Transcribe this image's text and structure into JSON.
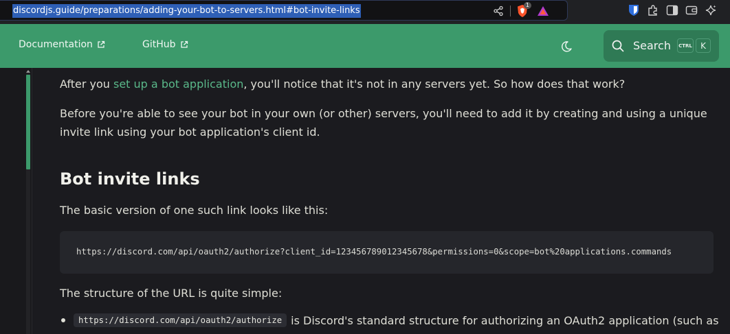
{
  "browser": {
    "url": "discordjs.guide/preparations/adding-your-bot-to-servers.html#bot-invite-links",
    "icons": [
      "share-icon",
      "brave-shield-icon",
      "brave-rewards-icon",
      "bitwarden-icon",
      "extensions-icon",
      "sidebar-icon",
      "wallet-icon",
      "leo-ai-icon"
    ],
    "brave_badge": "1"
  },
  "header": {
    "nav": [
      {
        "label": "Documentation",
        "icon": "external-link-icon"
      },
      {
        "label": "GitHub",
        "icon": "external-link-icon"
      }
    ],
    "theme_icon": "moon-icon",
    "search": {
      "label": "Search",
      "kbd_ctrl": "CTRL",
      "kbd_key": "K"
    }
  },
  "content": {
    "para1_before": "After you ",
    "para1_link": "set up a bot application",
    "para1_after": ", you'll notice that it's not in any servers yet. So how does that work?",
    "para2": "Before you're able to see your bot in your own (or other) servers, you'll need to add it by creating and using a unique invite link using your bot application's client id.",
    "heading": "Bot invite links",
    "para3": "The basic version of one such link looks like this:",
    "code": "https://discord.com/api/oauth2/authorize?client_id=123456789012345678&permissions=0&scope=bot%20applications.commands",
    "para4": "The structure of the URL is quite simple:",
    "bullet1_code": "https://discord.com/api/oauth2/authorize",
    "bullet1_text": "is Discord's standard structure for authorizing an OAuth2 application (such as"
  },
  "colors": {
    "accent": "#3c9a6b",
    "link": "#5ab98a",
    "background": "#1b1b1f",
    "code_bg": "#25262b"
  }
}
